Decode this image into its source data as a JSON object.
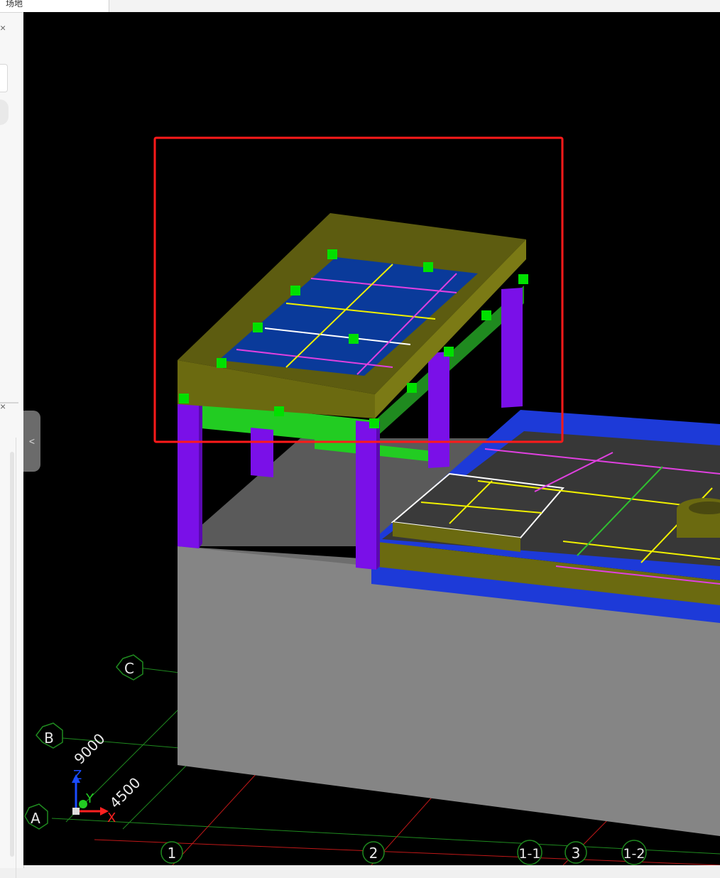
{
  "tab": {
    "label": "场地"
  },
  "panel": {
    "close_glyph": "×",
    "collapse_glyph": "<"
  },
  "grid": {
    "rows": [
      "A",
      "B",
      "C"
    ],
    "columns": [
      "1",
      "2",
      "1-1",
      "3",
      "1-2"
    ],
    "dimensions": [
      "9000",
      "4500"
    ]
  },
  "axes": {
    "x": "X",
    "y": "Y",
    "z": "Z"
  },
  "colors": {
    "viewport_bg": "#000000",
    "selection_box": "#ff1a1a",
    "grip": "#00e000",
    "column": "#7a10e8",
    "slab": "#0a3a9a",
    "beam": "#6b6a10",
    "wall": "#808080"
  }
}
